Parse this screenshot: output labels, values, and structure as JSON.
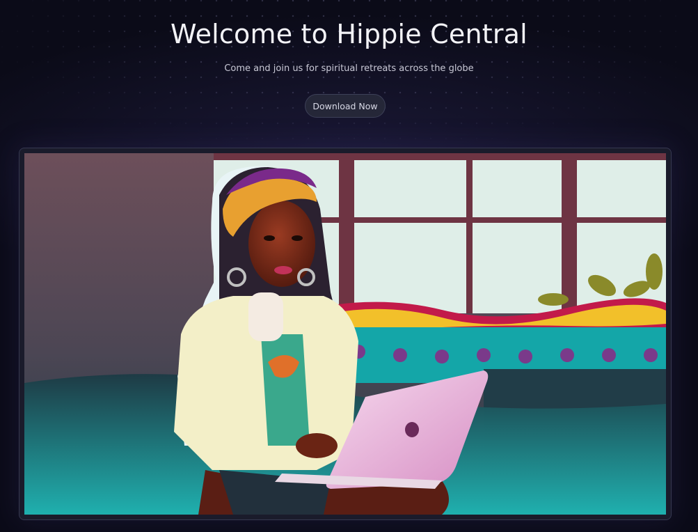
{
  "hero": {
    "title": "Welcome to Hippie Central",
    "subtitle": "Come and join us for spiritual retreats across the globe",
    "cta_label": "Download Now"
  },
  "colors": {
    "background": "#0b0b18",
    "button_bg": "#252738",
    "frame_border": "#363850"
  },
  "image": {
    "subject": "illustration of a woman with braided hair and headscarf using a laptop in front of a window"
  }
}
